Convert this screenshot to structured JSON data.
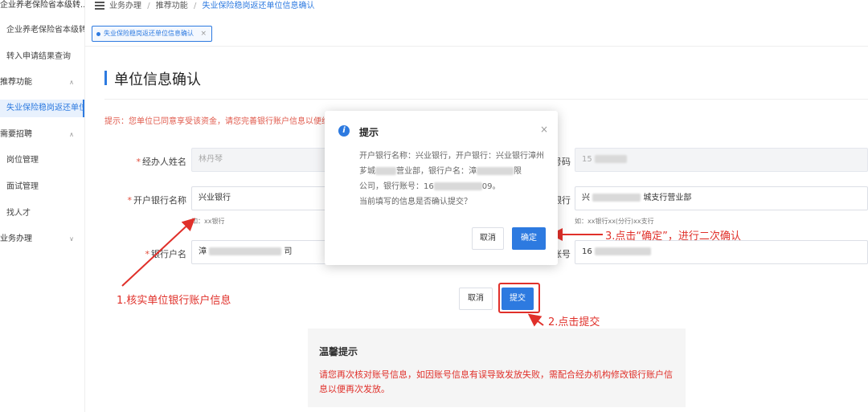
{
  "sidebar": {
    "items": [
      {
        "label": "企业养老保险省本级转...",
        "type": "group"
      },
      {
        "label": "企业养老保险省本级转",
        "type": "sub"
      },
      {
        "label": "转入申请结果查询",
        "type": "sub"
      },
      {
        "label": "推荐功能",
        "type": "group",
        "chevron": "∧"
      },
      {
        "label": "失业保险稳岗返还单位",
        "type": "sub",
        "active": true
      },
      {
        "label": "需要招聘",
        "type": "group",
        "chevron": "∧"
      },
      {
        "label": "岗位管理",
        "type": "sub"
      },
      {
        "label": "面试管理",
        "type": "sub"
      },
      {
        "label": "找人才",
        "type": "sub"
      },
      {
        "label": "业务办理",
        "type": "group",
        "chevron": "∨"
      }
    ]
  },
  "breadcrumb": {
    "items": [
      "业务办理",
      "推荐功能",
      "失业保险稳岗返还单位信息确认"
    ],
    "separator": "/"
  },
  "tab": {
    "label": "失业保险稳岗返还单位信息确认",
    "close": "×"
  },
  "page": {
    "title": "单位信息确认",
    "hint": "提示：您单位已同意享受该资金，请您完善银行账户信息以便经"
  },
  "form": {
    "operator_label": "经办人姓名",
    "operator_value": "林丹琴",
    "phone_label_tail": "号码",
    "phone_value": "15",
    "bank_label": "开户银行名称",
    "bank_value": "兴业银行",
    "bank_hint": "如：xx银行",
    "branch_label_tail": "银行",
    "branch_value_prefix": "兴",
    "branch_value_suffix": "城支行营业部",
    "branch_hint": "如：xx银行xx(分行)xx支行",
    "account_name_label": "银行户名",
    "account_name_prefix": "漳",
    "account_name_suffix": "司",
    "account_no_label_tail": "账号",
    "account_no_value": "16",
    "required_mark": "*",
    "cancel_label": "取消",
    "submit_label": "提交"
  },
  "modal": {
    "title": "提示",
    "icon": "i",
    "close": "×",
    "line1": "开户银行名称：兴业银行，开户银行：兴业银行漳州",
    "line2a": "芗城",
    "line2b": "营业部，银行户名：漳",
    "line3a": "公司，银行账号：16",
    "line3b": "09。",
    "line4": "当前填写的信息是否确认提交？",
    "line2_tail": "限",
    "cancel_label": "取消",
    "confirm_label": "确定"
  },
  "annotations": {
    "step1": "1.核实单位银行账户信息",
    "step2": "2.点击提交",
    "step3": "3.点击“确定”，进行二次确认"
  },
  "tips": {
    "title": "温馨提示",
    "text": "请您再次核对账号信息，如因账号信息有误导致发放失败，需配合经办机构修改银行账户信息以便再次发放。"
  },
  "colors": {
    "primary": "#2d7ae0",
    "annotation_red": "#e0302a",
    "hint_red": "#e05a4c"
  }
}
